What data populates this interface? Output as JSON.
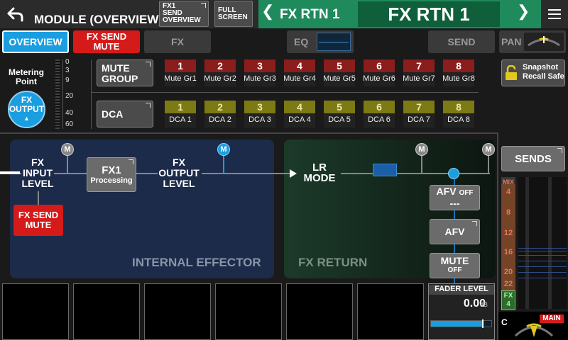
{
  "header": {
    "title": "MODULE (OVERVIEW)",
    "fx1_send_overview_lines": [
      "FX1",
      "SEND",
      "OVERVIEW"
    ],
    "full_screen_lines": [
      "FULL",
      "SCREEN"
    ],
    "channel_short": "FX RTN 1",
    "channel_name": "FX RTN 1",
    "prev_glyph": "❮",
    "next_glyph": "❯"
  },
  "tabs": {
    "overview": "OVERVIEW",
    "fx_send_mute_lines": [
      "FX SEND",
      "MUTE"
    ],
    "fx": "FX",
    "eq": "EQ",
    "send": "SEND",
    "pan": "PAN"
  },
  "metering": {
    "label_lines": [
      "Metering",
      "Point"
    ],
    "point_lines": [
      "FX",
      "OUTPUT"
    ],
    "scale": [
      "0",
      "3",
      "9",
      "20",
      "40",
      "60"
    ]
  },
  "mute_group": {
    "button_lines": [
      "MUTE",
      "GROUP"
    ],
    "cells": [
      {
        "num": "1",
        "label": "Mute Gr1"
      },
      {
        "num": "2",
        "label": "Mute Gr2"
      },
      {
        "num": "3",
        "label": "Mute Gr3"
      },
      {
        "num": "4",
        "label": "Mute Gr4"
      },
      {
        "num": "5",
        "label": "Mute Gr5"
      },
      {
        "num": "6",
        "label": "Mute Gr6"
      },
      {
        "num": "7",
        "label": "Mute Gr7"
      },
      {
        "num": "8",
        "label": "Mute Gr8"
      }
    ]
  },
  "dca": {
    "button": "DCA",
    "cells": [
      {
        "num": "1",
        "label": "DCA 1"
      },
      {
        "num": "2",
        "label": "DCA 2"
      },
      {
        "num": "3",
        "label": "DCA 3"
      },
      {
        "num": "4",
        "label": "DCA 4"
      },
      {
        "num": "5",
        "label": "DCA 5"
      },
      {
        "num": "6",
        "label": "DCA 6"
      },
      {
        "num": "7",
        "label": "DCA 7"
      },
      {
        "num": "8",
        "label": "DCA 8"
      }
    ]
  },
  "snapshot": {
    "lines": [
      "Snapshot",
      "Recall Safe"
    ]
  },
  "flow": {
    "fx_input_level_lines": [
      "FX",
      "INPUT",
      "LEVEL"
    ],
    "fx1_processing_title": "FX1",
    "fx1_processing_sub": "Processing",
    "fx_output_level_lines": [
      "FX",
      "OUTPUT",
      "LEVEL"
    ],
    "fx_send_mute_lines": [
      "FX SEND",
      "MUTE"
    ],
    "lr_mode_lines": [
      "LR",
      "MODE"
    ],
    "internal_effector": "INTERNAL EFFECTOR",
    "fx_return": "FX RETURN",
    "meter_mark": "M",
    "afv_off": {
      "title": "AFV",
      "state": "OFF",
      "value": "---"
    },
    "afv": "AFV",
    "mute": {
      "title": "MUTE",
      "state": "OFF"
    }
  },
  "fader": {
    "title": "FADER LEVEL",
    "value": "0.00",
    "unit": "dB",
    "level_fraction": 0.85
  },
  "sends": {
    "button": "SENDS",
    "mix_header": "MIX",
    "mix_numbers": [
      "4",
      "8",
      "12",
      "16",
      "20",
      "22"
    ],
    "fx_badge_lines": [
      "FX",
      "4"
    ]
  },
  "pan_readout": {
    "value": "C",
    "main": "MAIN"
  },
  "colors": {
    "accent_blue": "#1a9ee0",
    "mute_red": "#d51a1a",
    "channel_green": "#1f8a5c",
    "dca_olive": "#7c7a12"
  }
}
